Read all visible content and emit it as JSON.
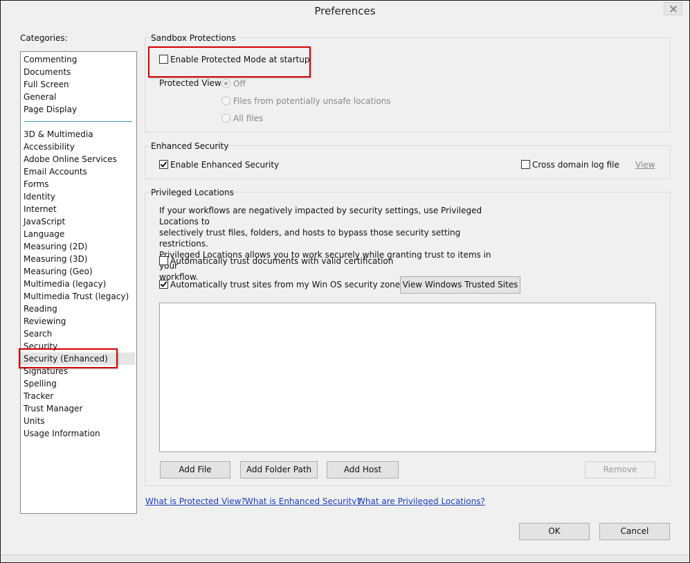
{
  "window": {
    "title": "Preferences"
  },
  "categories": {
    "label": "Categories:",
    "group1": [
      "Commenting",
      "Documents",
      "Full Screen",
      "General",
      "Page Display"
    ],
    "group2": [
      "3D & Multimedia",
      "Accessibility",
      "Adobe Online Services",
      "Email Accounts",
      "Forms",
      "Identity",
      "Internet",
      "JavaScript",
      "Language",
      "Measuring (2D)",
      "Measuring (3D)",
      "Measuring (Geo)",
      "Multimedia (legacy)",
      "Multimedia Trust (legacy)",
      "Reading",
      "Reviewing",
      "Search",
      "Security",
      "Security (Enhanced)",
      "Signatures",
      "Spelling",
      "Tracker",
      "Trust Manager",
      "Units",
      "Usage Information"
    ],
    "selected": "Security (Enhanced)"
  },
  "sandbox": {
    "title": "Sandbox Protections",
    "protected_mode_label": "Enable Protected Mode at startup",
    "protected_mode_checked": false,
    "protected_view_label": "Protected View",
    "options": [
      "Off",
      "Files from potentially unsafe locations",
      "All files"
    ],
    "selected_option": "Off"
  },
  "enhanced": {
    "title": "Enhanced Security",
    "enable_label": "Enable Enhanced Security",
    "enable_checked": true,
    "cross_domain_label": "Cross domain log file",
    "cross_domain_checked": false,
    "view_link": "View"
  },
  "privileged": {
    "title": "Privileged Locations",
    "description": "If your workflows are negatively impacted by security settings, use Privileged Locations to selectively trust files, folders, and hosts to bypass those security setting restrictions. Privileged Locations allows you to work securely while granting trust to items in your workflow.",
    "desc_lines": [
      "If your workflows are negatively impacted by security settings, use Privileged Locations to",
      "selectively trust files, folders, and hosts to bypass those security setting restrictions.",
      "Privileged Locations allows you to work securely while granting trust to items in your",
      "workflow."
    ],
    "trust_cert_label": "Automatically trust documents with valid certification",
    "trust_cert_checked": false,
    "trust_sites_label": "Automatically trust sites from my Win OS security zones",
    "trust_sites_checked": true,
    "view_sites_button": "View Windows Trusted Sites",
    "add_file": "Add File",
    "add_folder": "Add Folder Path",
    "add_host": "Add Host",
    "remove": "Remove"
  },
  "links": {
    "protected_view": "What is Protected View?",
    "enhanced_security": "What is Enhanced Security?",
    "privileged_locations": "What are Privileged Locations?"
  },
  "footer": {
    "ok": "OK",
    "cancel": "Cancel"
  },
  "colors": {
    "highlight_border": "#d40000",
    "link": "#1a3ec2"
  }
}
